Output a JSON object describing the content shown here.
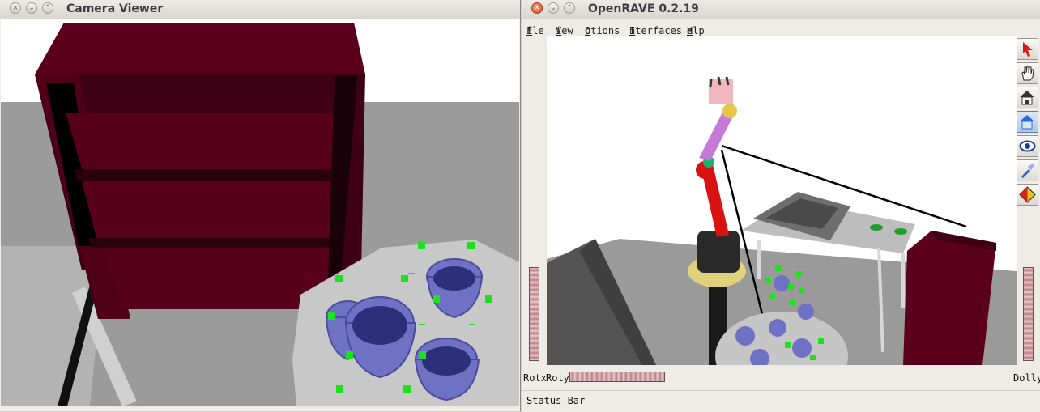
{
  "camera_window": {
    "title": "Camera Viewer"
  },
  "openrave_window": {
    "title": "OpenRAVE 0.2.19",
    "menu": [
      {
        "underline": "F",
        "rest": "ile"
      },
      {
        "underline": "V",
        "rest": "iew"
      },
      {
        "underline": "O",
        "rest": "ptions"
      },
      {
        "underline": "I",
        "rest": "nterfaces"
      },
      {
        "underline": "H",
        "rest": "elp"
      }
    ],
    "tools": [
      "select-arrow-icon",
      "hand-icon",
      "home-icon",
      "house-view-icon",
      "camera-eye-icon",
      "flashlight-icon",
      "shade-icon"
    ],
    "rotx_label": "Rotx",
    "roty_label": "Roty",
    "dolly_label": "Dolly",
    "status_text": "Status Bar"
  },
  "colors": {
    "shelf": "#4f0018",
    "table": "#c9c9c9",
    "cups": "#6f72c4",
    "marker": "#1ee01e",
    "floor": "#9a9a9a"
  }
}
